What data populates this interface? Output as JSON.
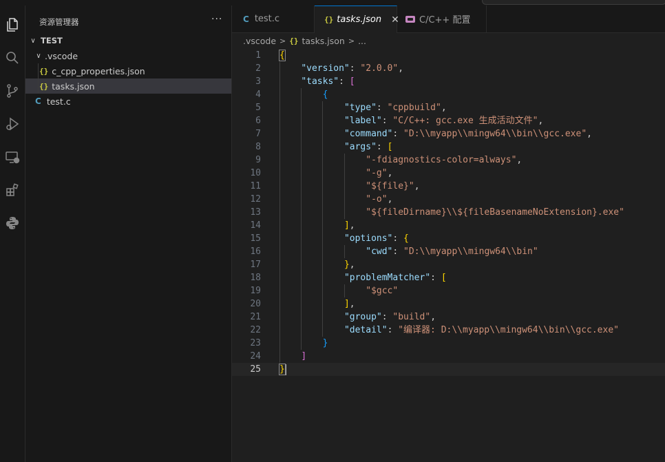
{
  "activity_bar": [
    "explorer-icon",
    "search-icon",
    "source-control-icon",
    "run-debug-icon",
    "remote-explorer-icon",
    "extensions-icon",
    "python-icon"
  ],
  "sidebar": {
    "title": "资源管理器",
    "more": "···",
    "folder": "TEST",
    "items": [
      {
        "name": ".vscode",
        "type": "folder"
      },
      {
        "name": "c_cpp_properties.json",
        "type": "json",
        "icon": "{}"
      },
      {
        "name": "tasks.json",
        "type": "json",
        "icon": "{}",
        "selected": true
      },
      {
        "name": "test.c",
        "type": "c",
        "icon": "C"
      }
    ]
  },
  "tabs": [
    {
      "label": "test.c",
      "icon": "C"
    },
    {
      "label": "tasks.json",
      "icon": "{}",
      "active": true,
      "close": "✕"
    },
    {
      "label": "C/C++ 配置",
      "icon": "gear-badge"
    }
  ],
  "breadcrumb": [
    ".vscode",
    "tasks.json",
    "..."
  ],
  "editor": {
    "current_line": 25,
    "lines": [
      "{",
      "    \"version\": \"2.0.0\",",
      "    \"tasks\": [",
      "        {",
      "            \"type\": \"cppbuild\",",
      "            \"label\": \"C/C++: gcc.exe 生成活动文件\",",
      "            \"command\": \"D:\\\\myapp\\\\mingw64\\\\bin\\\\gcc.exe\",",
      "            \"args\": [",
      "                \"-fdiagnostics-color=always\",",
      "                \"-g\",",
      "                \"${file}\",",
      "                \"-o\",",
      "                \"${fileDirname}\\\\${fileBasenameNoExtension}.exe\"",
      "            ],",
      "            \"options\": {",
      "                \"cwd\": \"D:\\\\myapp\\\\mingw64\\\\bin\"",
      "            },",
      "            \"problemMatcher\": [",
      "                \"$gcc\"",
      "            ],",
      "            \"group\": \"build\",",
      "            \"detail\": \"编译器: D:\\\\myapp\\\\mingw64\\\\bin\\\\gcc.exe\"",
      "        }",
      "    ]",
      "}"
    ]
  },
  "colors": {
    "key": "#9cdcfe",
    "string": "#ce9178",
    "bracket_level1": "#ffd700",
    "bracket_level2": "#da70d6",
    "bracket_level3": "#179fff",
    "accent": "#0078d4"
  }
}
